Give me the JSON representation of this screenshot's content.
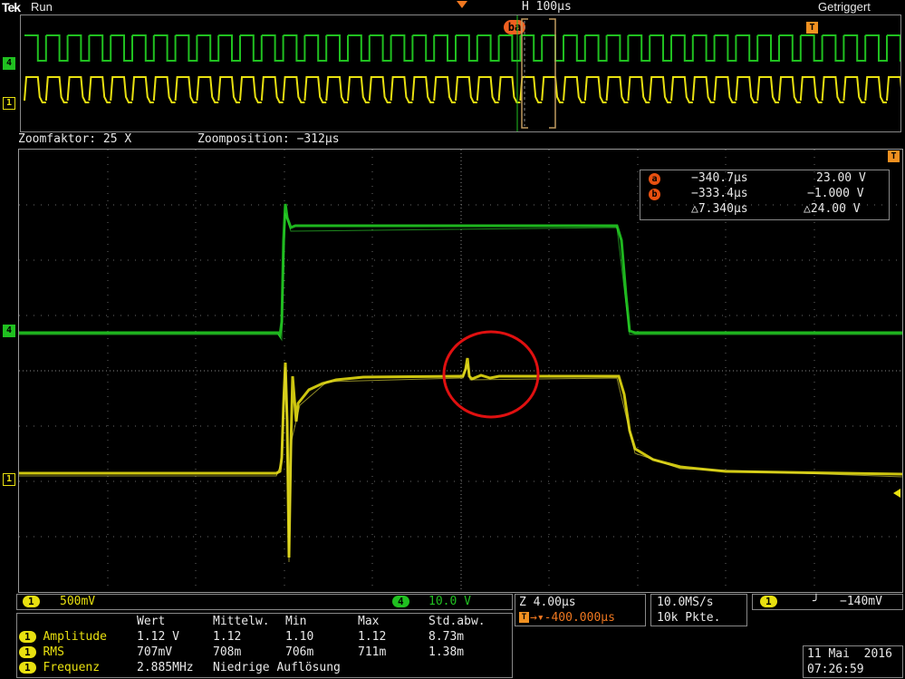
{
  "header": {
    "brand": "Tek",
    "state": "Run",
    "h_scale": "H 100µs",
    "trigger_status": "Getriggert",
    "cursor_marker": "ba",
    "trigger_marker": "T"
  },
  "zoom": {
    "factor": "Zoomfaktor: 25 X",
    "position": "Zoomposition: −312µs"
  },
  "channels": {
    "ch4_label": "4",
    "ch1_label": "1"
  },
  "cursors": {
    "a_label": "a",
    "b_label": "b",
    "a_time": "−340.7µs",
    "a_volt": "23.00 V",
    "b_time": "−333.4µs",
    "b_volt": "−1.000 V",
    "delta_time": "△7.340µs",
    "delta_volt": "△24.00 V"
  },
  "status_bar": {
    "ch1_num": "1",
    "ch1_scale": "500mV",
    "ch4_num": "4",
    "ch4_scale": "10.0 V",
    "zoom_scale": "Z 4.00µs",
    "trigger_position": "→▾-400.000µs",
    "trigger_pos_mark": "T",
    "sample_rate": "10.0MS/s",
    "record_length": "10k Pkte.",
    "trig_source": "1",
    "trig_slope": "╯",
    "trig_level": "−140mV"
  },
  "measurements": {
    "headers": [
      "",
      "Wert",
      "Mittelw.",
      "Min",
      "Max",
      "Std.abw."
    ],
    "rows": [
      {
        "ch": "1",
        "name": "Amplitude",
        "values": [
          "1.12 V",
          "1.12",
          "1.10",
          "1.12",
          "8.73m"
        ]
      },
      {
        "ch": "1",
        "name": "RMS",
        "values": [
          "707mV",
          "708m",
          "706m",
          "711m",
          "1.38m"
        ]
      },
      {
        "ch": "1",
        "name": "Frequenz",
        "values": [
          "2.885MHz",
          "Niedrige Auflösung",
          "",
          "",
          ""
        ]
      }
    ]
  },
  "datetime": {
    "date": "11 Mai  2016",
    "time": "07:26:59"
  },
  "colors": {
    "ch1": "#e8e010",
    "ch4": "#20c020",
    "cursor": "#f07820",
    "annotation": "#e01010",
    "grid": "#6a6a6a"
  }
}
